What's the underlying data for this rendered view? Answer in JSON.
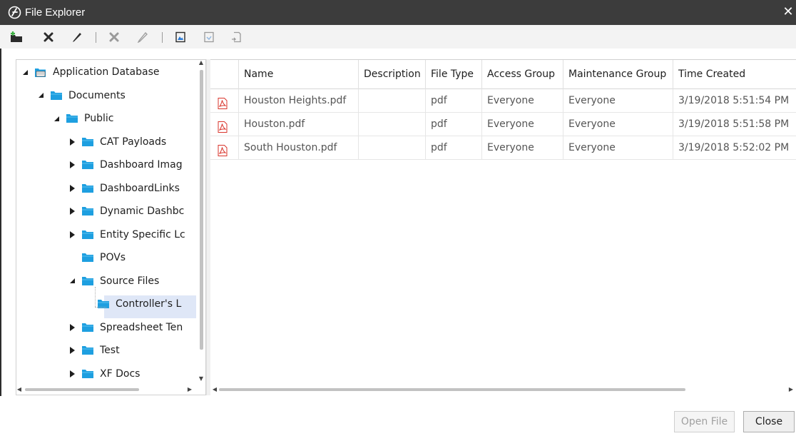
{
  "window": {
    "title": "File Explorer",
    "close_glyph": "✕"
  },
  "toolbar": {
    "buttons": [
      {
        "name": "new-folder-icon",
        "enabled": true
      },
      {
        "name": "delete-folder-icon",
        "enabled": true
      },
      {
        "name": "rename-folder-icon",
        "enabled": true
      },
      {
        "name": "delete-file-icon",
        "enabled": false
      },
      {
        "name": "rename-file-icon",
        "enabled": false
      },
      {
        "name": "upload-image-icon",
        "enabled": true
      },
      {
        "name": "download-file-icon",
        "enabled": false
      },
      {
        "name": "export-file-icon",
        "enabled": false
      }
    ]
  },
  "tree": {
    "items": [
      {
        "label": "Application Database",
        "level": 0,
        "expanded": true,
        "has_children": true,
        "icon": "database-icon"
      },
      {
        "label": "Documents",
        "level": 1,
        "expanded": true,
        "has_children": true,
        "icon": "folder-icon"
      },
      {
        "label": "Public",
        "level": 2,
        "expanded": true,
        "has_children": true,
        "icon": "folder-icon"
      },
      {
        "label": "CAT Payloads",
        "level": 3,
        "expanded": false,
        "has_children": true,
        "icon": "folder-icon"
      },
      {
        "label": "Dashboard Imag",
        "level": 3,
        "expanded": false,
        "has_children": true,
        "icon": "folder-icon"
      },
      {
        "label": "DashboardLinks",
        "level": 3,
        "expanded": false,
        "has_children": true,
        "icon": "folder-icon"
      },
      {
        "label": "Dynamic Dashbc",
        "level": 3,
        "expanded": false,
        "has_children": true,
        "icon": "folder-icon"
      },
      {
        "label": "Entity Specific Lc",
        "level": 3,
        "expanded": false,
        "has_children": true,
        "icon": "folder-icon"
      },
      {
        "label": "POVs",
        "level": 3,
        "expanded": false,
        "has_children": false,
        "icon": "folder-icon"
      },
      {
        "label": "Source Files",
        "level": 3,
        "expanded": true,
        "has_children": true,
        "icon": "folder-icon"
      },
      {
        "label": "Controller's L",
        "level": 4,
        "expanded": false,
        "has_children": false,
        "icon": "folder-icon",
        "selected": true
      },
      {
        "label": "Spreadsheet Ten",
        "level": 3,
        "expanded": false,
        "has_children": true,
        "icon": "folder-icon"
      },
      {
        "label": "Test",
        "level": 3,
        "expanded": false,
        "has_children": true,
        "icon": "folder-icon"
      },
      {
        "label": "XF Docs",
        "level": 3,
        "expanded": false,
        "has_children": true,
        "icon": "folder-icon"
      }
    ]
  },
  "grid": {
    "columns": [
      "Name",
      "Description",
      "File Type",
      "Access Group",
      "Maintenance Group",
      "Time Created"
    ],
    "rows": [
      {
        "icon": "pdf-icon",
        "cells": [
          "Houston Heights.pdf",
          "",
          "pdf",
          "Everyone",
          "Everyone",
          "3/19/2018 5:51:54 PM"
        ]
      },
      {
        "icon": "pdf-icon",
        "cells": [
          "Houston.pdf",
          "",
          "pdf",
          "Everyone",
          "Everyone",
          "3/19/2018 5:51:58 PM"
        ]
      },
      {
        "icon": "pdf-icon",
        "cells": [
          "South Houston.pdf",
          "",
          "pdf",
          "Everyone",
          "Everyone",
          "3/19/2018 5:52:02 PM"
        ]
      }
    ]
  },
  "footer": {
    "open_file_label": "Open File",
    "open_file_enabled": false,
    "close_label": "Close"
  },
  "colors": {
    "titlebar": "#3c3c3c",
    "folder": "#1e9fe0",
    "selection": "#dfe7f7",
    "pdf": "#d9342b"
  }
}
